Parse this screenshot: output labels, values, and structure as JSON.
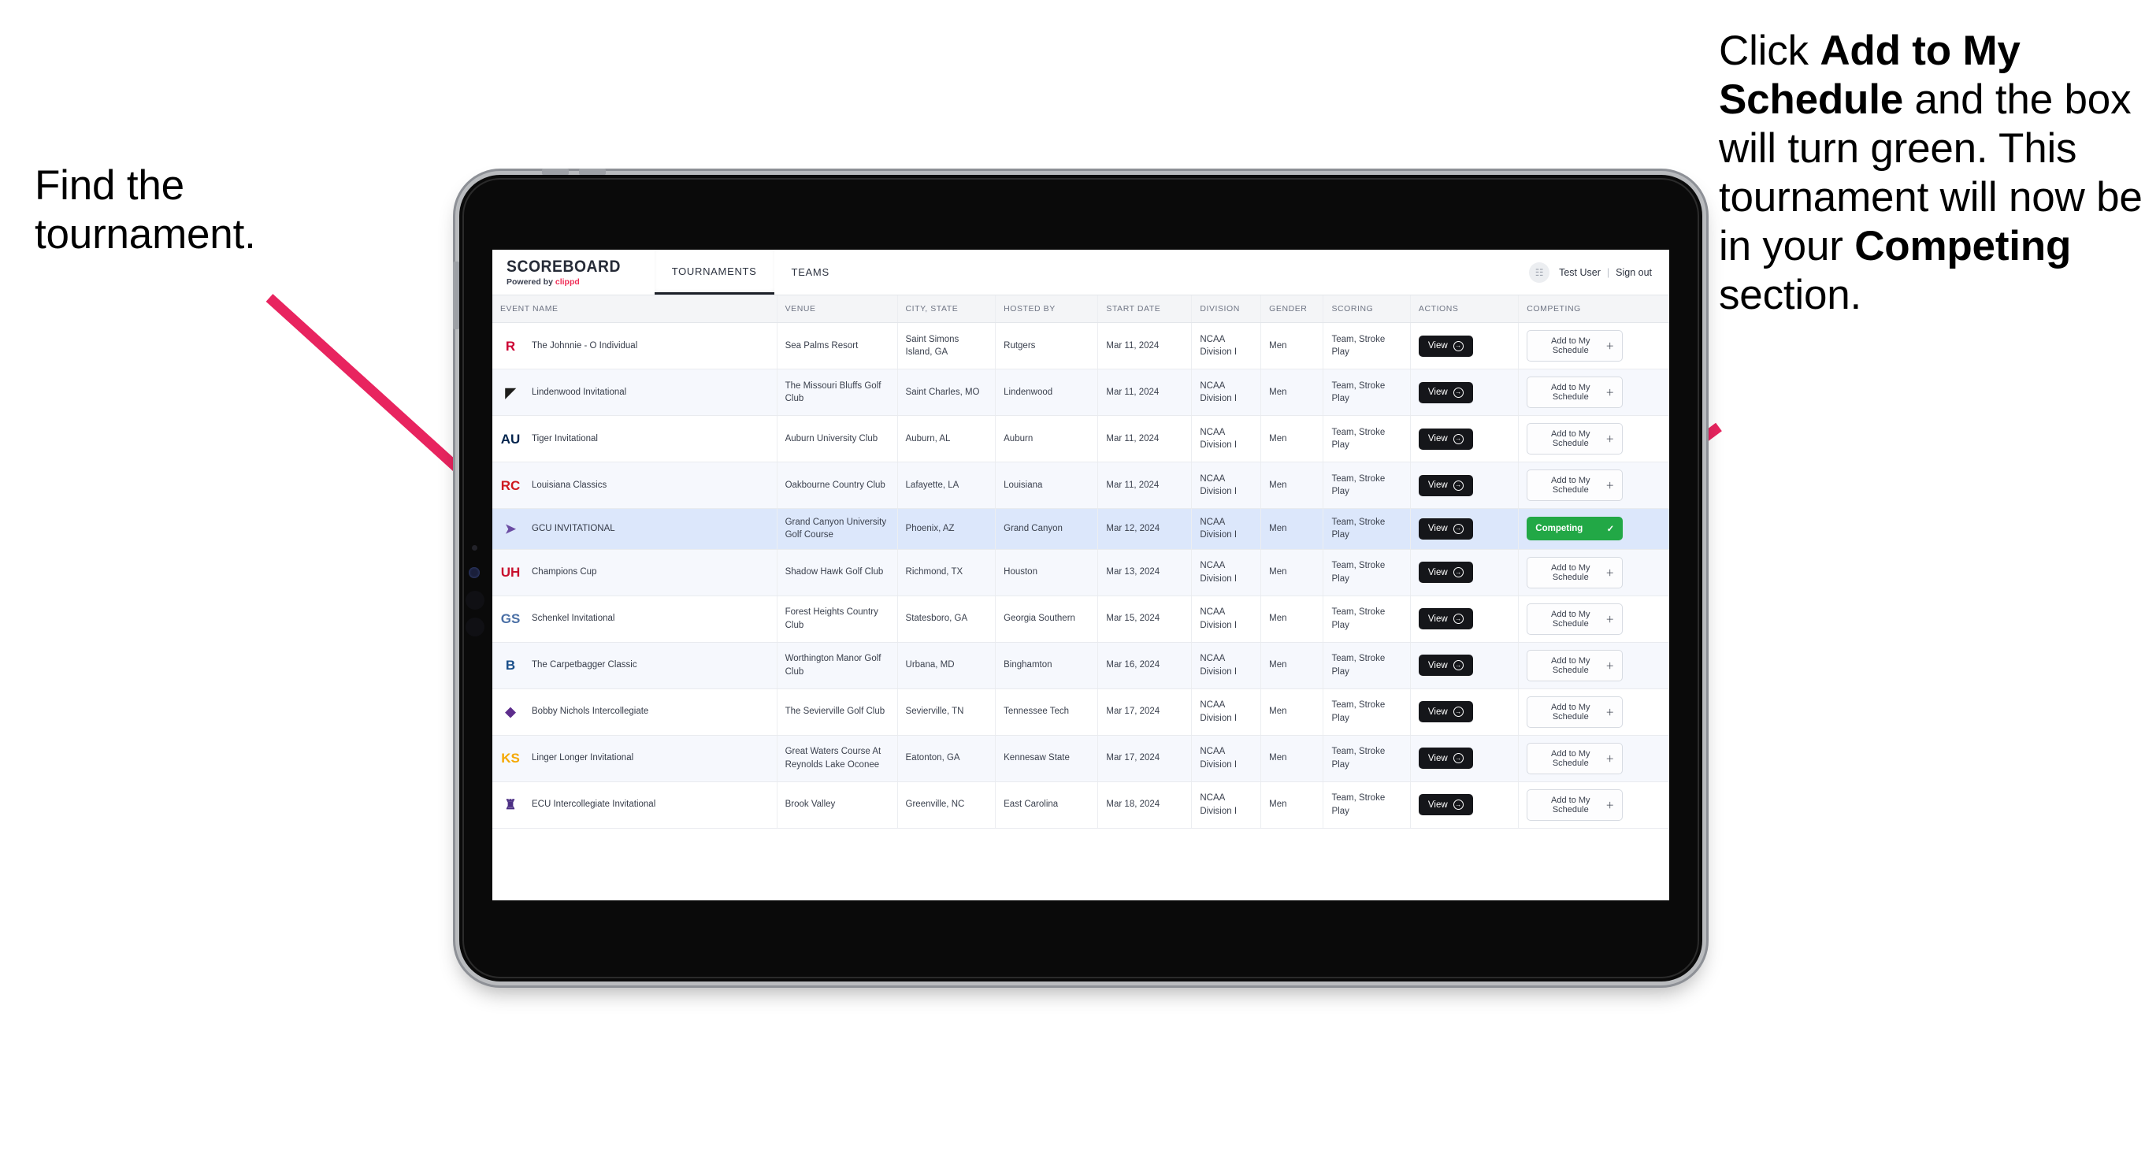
{
  "annotations": {
    "left": {
      "lines": [
        "Find the",
        "tournament."
      ]
    },
    "right": {
      "segments": [
        {
          "text": "Click ",
          "bold": false
        },
        {
          "text": "Add to My Schedule",
          "bold": true
        },
        {
          "text": " and the box will turn green. This tournament will now be in your ",
          "bold": false
        },
        {
          "text": "Competing",
          "bold": true
        },
        {
          "text": " section.",
          "bold": false
        }
      ]
    },
    "arrow_color": "#e8245f"
  },
  "app": {
    "brand": {
      "title": "SCOREBOARD",
      "powered_prefix": "Powered by ",
      "powered_brand": "clippd",
      "brand_color": "#ef2d56"
    },
    "nav": [
      {
        "label": "TOURNAMENTS",
        "active": true
      },
      {
        "label": "TEAMS",
        "active": false
      }
    ],
    "user": {
      "avatar_icon": "user-avatar-icon",
      "name": "Test User",
      "separator": "|",
      "signout": "Sign out"
    }
  },
  "table": {
    "columns": [
      "EVENT NAME",
      "VENUE",
      "CITY, STATE",
      "HOSTED BY",
      "START DATE",
      "DIVISION",
      "GENDER",
      "SCORING",
      "ACTIONS",
      "COMPETING"
    ],
    "action_label": "View",
    "add_label": "Add to My Schedule",
    "add_icon": "plus-icon",
    "competing_label": "Competing",
    "competing_icon": "check-icon",
    "competing_color": "#22a846",
    "rows": [
      {
        "logo": {
          "text": "R",
          "color": "#cc0033",
          "bg": "transparent",
          "name": "rutgers-logo"
        },
        "event": "The Johnnie - O Individual",
        "venue": "Sea Palms Resort",
        "city": "Saint Simons Island, GA",
        "host": "Rutgers",
        "date": "Mar 11, 2024",
        "division": "NCAA Division I",
        "gender": "Men",
        "scoring": "Team, Stroke Play",
        "competing": false
      },
      {
        "logo": {
          "text": "◤",
          "color": "#1d1d1b",
          "bg": "transparent",
          "name": "lindenwood-logo"
        },
        "event": "Lindenwood Invitational",
        "venue": "The Missouri Bluffs Golf Club",
        "city": "Saint Charles, MO",
        "host": "Lindenwood",
        "date": "Mar 11, 2024",
        "division": "NCAA Division I",
        "gender": "Men",
        "scoring": "Team, Stroke Play",
        "competing": false
      },
      {
        "logo": {
          "text": "AU",
          "color": "#03244d",
          "bg": "transparent",
          "name": "auburn-logo"
        },
        "event": "Tiger Invitational",
        "venue": "Auburn University Club",
        "city": "Auburn, AL",
        "host": "Auburn",
        "date": "Mar 11, 2024",
        "division": "NCAA Division I",
        "gender": "Men",
        "scoring": "Team, Stroke Play",
        "competing": false
      },
      {
        "logo": {
          "text": "RC",
          "color": "#ce181e",
          "bg": "transparent",
          "name": "louisiana-ragin-cajuns-logo"
        },
        "event": "Louisiana Classics",
        "venue": "Oakbourne Country Club",
        "city": "Lafayette, LA",
        "host": "Louisiana",
        "date": "Mar 11, 2024",
        "division": "NCAA Division I",
        "gender": "Men",
        "scoring": "Team, Stroke Play",
        "competing": false
      },
      {
        "logo": {
          "text": "➤",
          "color": "#6b4ca3",
          "bg": "transparent",
          "name": "grand-canyon-lopes-logo"
        },
        "event": "GCU INVITATIONAL",
        "venue": "Grand Canyon University Golf Course",
        "city": "Phoenix, AZ",
        "host": "Grand Canyon",
        "date": "Mar 12, 2024",
        "division": "NCAA Division I",
        "gender": "Men",
        "scoring": "Team, Stroke Play",
        "competing": true,
        "selected": true
      },
      {
        "logo": {
          "text": "UH",
          "color": "#c8102e",
          "bg": "transparent",
          "name": "houston-logo"
        },
        "event": "Champions Cup",
        "venue": "Shadow Hawk Golf Club",
        "city": "Richmond, TX",
        "host": "Houston",
        "date": "Mar 13, 2024",
        "division": "NCAA Division I",
        "gender": "Men",
        "scoring": "Team, Stroke Play",
        "competing": false
      },
      {
        "logo": {
          "text": "GS",
          "color": "#4a6fa5",
          "bg": "transparent",
          "name": "georgia-southern-logo"
        },
        "event": "Schenkel Invitational",
        "venue": "Forest Heights Country Club",
        "city": "Statesboro, GA",
        "host": "Georgia Southern",
        "date": "Mar 15, 2024",
        "division": "NCAA Division I",
        "gender": "Men",
        "scoring": "Team, Stroke Play",
        "competing": false
      },
      {
        "logo": {
          "text": "B",
          "color": "#1a4f8a",
          "bg": "transparent",
          "name": "binghamton-logo"
        },
        "event": "The Carpetbagger Classic",
        "venue": "Worthington Manor Golf Club",
        "city": "Urbana, MD",
        "host": "Binghamton",
        "date": "Mar 16, 2024",
        "division": "NCAA Division I",
        "gender": "Men",
        "scoring": "Team, Stroke Play",
        "competing": false
      },
      {
        "logo": {
          "text": "◆",
          "color": "#5d2d8c",
          "bg": "transparent",
          "name": "tennessee-tech-logo"
        },
        "event": "Bobby Nichols Intercollegiate",
        "venue": "The Sevierville Golf Club",
        "city": "Sevierville, TN",
        "host": "Tennessee Tech",
        "date": "Mar 17, 2024",
        "division": "NCAA Division I",
        "gender": "Men",
        "scoring": "Team, Stroke Play",
        "competing": false
      },
      {
        "logo": {
          "text": "KS",
          "color": "#f5a800",
          "bg": "transparent",
          "name": "kennesaw-state-logo"
        },
        "event": "Linger Longer Invitational",
        "venue": "Great Waters Course At Reynolds Lake Oconee",
        "city": "Eatonton, GA",
        "host": "Kennesaw State",
        "date": "Mar 17, 2024",
        "division": "NCAA Division I",
        "gender": "Men",
        "scoring": "Team, Stroke Play",
        "competing": false
      },
      {
        "logo": {
          "text": "♜",
          "color": "#4b2e83",
          "bg": "transparent",
          "name": "east-carolina-logo"
        },
        "event": "ECU Intercollegiate Invitational",
        "venue": "Brook Valley",
        "city": "Greenville, NC",
        "host": "East Carolina",
        "date": "Mar 18, 2024",
        "division": "NCAA Division I",
        "gender": "Men",
        "scoring": "Team, Stroke Play",
        "competing": false,
        "cut_off": true
      }
    ]
  }
}
